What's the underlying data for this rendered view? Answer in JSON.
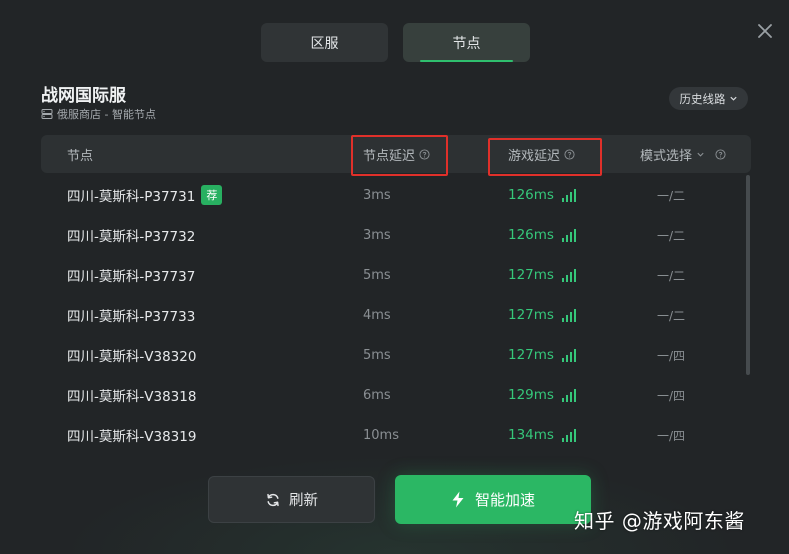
{
  "tabs": [
    {
      "label": "区服",
      "active": false
    },
    {
      "label": "节点",
      "active": true
    }
  ],
  "header": {
    "title": "战网国际服",
    "subtitle": "俄服商店 - 智能节点",
    "history_label": "历史线路"
  },
  "table": {
    "headers": {
      "node": "节点",
      "node_latency": "节点延迟",
      "game_latency": "游戏延迟",
      "mode": "模式选择"
    },
    "rows": [
      {
        "name": "四川-莫斯科-P37731",
        "badge": "荐",
        "node_latency": "3ms",
        "game_latency": "126ms",
        "mode": "一/二"
      },
      {
        "name": "四川-莫斯科-P37732",
        "badge": "",
        "node_latency": "3ms",
        "game_latency": "126ms",
        "mode": "一/二"
      },
      {
        "name": "四川-莫斯科-P37737",
        "badge": "",
        "node_latency": "5ms",
        "game_latency": "127ms",
        "mode": "一/二"
      },
      {
        "name": "四川-莫斯科-P37733",
        "badge": "",
        "node_latency": "4ms",
        "game_latency": "127ms",
        "mode": "一/二"
      },
      {
        "name": "四川-莫斯科-V38320",
        "badge": "",
        "node_latency": "5ms",
        "game_latency": "127ms",
        "mode": "一/四"
      },
      {
        "name": "四川-莫斯科-V38318",
        "badge": "",
        "node_latency": "6ms",
        "game_latency": "129ms",
        "mode": "一/四"
      },
      {
        "name": "四川-莫斯科-V38319",
        "badge": "",
        "node_latency": "10ms",
        "game_latency": "134ms",
        "mode": "一/四"
      }
    ]
  },
  "buttons": {
    "refresh": "刷新",
    "accelerate": "智能加速"
  },
  "watermark": "知乎 @游戏阿东酱",
  "colors": {
    "accent": "#2bb764",
    "latency_good": "#35c77a",
    "highlight_box": "#e0302a"
  },
  "icons": {
    "close": "close-icon",
    "server": "server-icon",
    "chevron": "chevron-down-icon",
    "help": "question-circle-icon",
    "signal": "signal-bars-icon",
    "refresh": "refresh-icon",
    "lightning": "lightning-icon"
  }
}
